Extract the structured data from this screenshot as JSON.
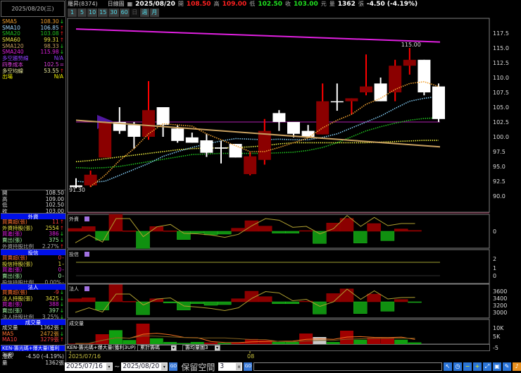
{
  "left_panel": {
    "date": "2025/08/20(三)",
    "ma_list": [
      {
        "label": "SMA5",
        "value": "108.30",
        "arrow": "↓",
        "color": "#f0a030",
        "dir": "dn"
      },
      {
        "label": "SMA10",
        "value": "106.85",
        "arrow": "↑",
        "color": "#a0d8ff",
        "dir": "up"
      },
      {
        "label": "SMA20",
        "value": "103.08",
        "arrow": "↑",
        "color": "#20c020",
        "dir": "up"
      },
      {
        "label": "SMA60",
        "value": "99.31",
        "arrow": "↑",
        "color": "#e8e040",
        "dir": "up"
      },
      {
        "label": "SMA120",
        "value": "98.33",
        "arrow": "↓",
        "color": "#c8a060",
        "dir": "dn"
      },
      {
        "label": "SMA240",
        "value": "115.98",
        "arrow": "↓",
        "color": "#e020e0",
        "dir": "dn"
      },
      {
        "label": "多空趨勢線",
        "value": "N/A",
        "arrow": "",
        "color": "#9040ff",
        "dir": ""
      },
      {
        "label": "四季成本",
        "value": "102.5",
        "arrow": "=",
        "color": "#e040e0",
        "dir": ""
      },
      {
        "label": "多空均線",
        "value": "53.55",
        "arrow": "↑",
        "color": "#f0f0a0",
        "dir": "up"
      },
      {
        "label": "出場",
        "value": "N/A",
        "arrow": "",
        "color": "#f0f000",
        "dir": ""
      }
    ],
    "ohlc": [
      {
        "label": "開",
        "value": "108.50"
      },
      {
        "label": "高",
        "value": "109.00"
      },
      {
        "label": "低",
        "value": "102.50"
      },
      {
        "label": "收",
        "value": "103.00"
      }
    ],
    "sections": [
      {
        "title": "外資",
        "rows": [
          {
            "label": "買賣超(張)",
            "value": "11",
            "arrow": "↑",
            "lc": "#ff7030",
            "vc": "#ff4040",
            "dir": "up"
          },
          {
            "label": "外資持股(張)",
            "value": "2554",
            "arrow": "↑",
            "lc": "#e8e040",
            "vc": "#e8e040",
            "dir": "up"
          },
          {
            "label": "買進(張)",
            "value": "386",
            "arrow": "↓",
            "lc": "#e020e0",
            "vc": "#e020e0",
            "dir": "dn"
          },
          {
            "label": "賣出(張)",
            "value": "375",
            "arrow": "↓",
            "lc": "#a0f0a0",
            "vc": "#a0f0a0",
            "dir": "dn"
          },
          {
            "label": "外資持股比例",
            "value": "2.27%",
            "arrow": "↑",
            "lc": "#aaa",
            "vc": "#aaa",
            "dir": "up"
          }
        ]
      },
      {
        "title": "投信",
        "rows": [
          {
            "label": "買賣超(張)",
            "value": "0",
            "arrow": "-",
            "lc": "#ff7030",
            "vc": "#ff4040",
            "dir": ""
          },
          {
            "label": "投信持股(張)",
            "value": "1",
            "arrow": "-",
            "lc": "#e8e040",
            "vc": "#e8e040",
            "dir": ""
          },
          {
            "label": "買進(張)",
            "value": "0",
            "arrow": "-",
            "lc": "#e020e0",
            "vc": "#e020e0",
            "dir": ""
          },
          {
            "label": "賣出(張)",
            "value": "0",
            "arrow": "-",
            "lc": "#a0f0a0",
            "vc": "#a0f0a0",
            "dir": ""
          },
          {
            "label": "投信持股比例",
            "value": "0.00%",
            "arrow": "-",
            "lc": "#aaa",
            "vc": "#aaa",
            "dir": ""
          }
        ]
      },
      {
        "title": "法人",
        "rows": [
          {
            "label": "買賣超(張)",
            "value": "-9",
            "arrow": "↓",
            "lc": "#ff7030",
            "vc": "#ff4040",
            "dir": "dn"
          },
          {
            "label": "法人持股(張)",
            "value": "3425",
            "arrow": "↓",
            "lc": "#e8e040",
            "vc": "#e8e040",
            "dir": "dn"
          },
          {
            "label": "買進(張)",
            "value": "388",
            "arrow": "↓",
            "lc": "#e020e0",
            "vc": "#e020e0",
            "dir": "dn"
          },
          {
            "label": "賣出(張)",
            "value": "397",
            "arrow": "↓",
            "lc": "#a0f0a0",
            "vc": "#a0f0a0",
            "dir": "dn"
          },
          {
            "label": "法人持股比例",
            "value": "3.25%",
            "arrow": "↓",
            "lc": "#aaa",
            "vc": "#aaa",
            "dir": "dn"
          }
        ]
      },
      {
        "title": "成交量",
        "rows": [
          {
            "label": "成交量",
            "value": "1362張",
            "arrow": "↓",
            "lc": "#ddd",
            "vc": "#ddd",
            "dir": "dn"
          },
          {
            "label": "MA5",
            "value": "2472張",
            "arrow": "↓",
            "lc": "#ff7030",
            "vc": "#f0a030",
            "dir": "dn"
          },
          {
            "label": "MA10",
            "value": "3279張",
            "arrow": "↑",
            "lc": "#ff4040",
            "vc": "#ff4040",
            "dir": "up"
          }
        ]
      }
    ],
    "indicator_title": "KEN-籌光碼+爆大量(獲利3UP)",
    "change_label": "漲跌",
    "change_value": "-4.50 (-4.19%)",
    "volume_label": "量",
    "volume_value": "1362張"
  },
  "header": {
    "stock": "羅昇(8374)",
    "chart_type": "日線圖",
    "date": "2025/08/20",
    "open_label": "開",
    "open": "108.50",
    "high_label": "高",
    "high": "109.00",
    "low_label": "低",
    "low": "102.50",
    "close_label": "收",
    "close": "103.00",
    "unit": "元",
    "vol_label": "量",
    "vol": "1362",
    "vol_unit": "張",
    "change": "-4.50 (-4.19%)"
  },
  "periods": [
    "1",
    "5",
    "10",
    "15",
    "30",
    "60",
    "日",
    "週",
    "月"
  ],
  "active_period": "日",
  "colors": {
    "up": "#8b0000",
    "down": "#ffffff",
    "up_wick": "#ff0000",
    "frame": "#808080"
  },
  "chart_data": [
    {
      "type": "candlestick",
      "yticks": [
        "117.5",
        "115.0",
        "112.5",
        "110.0",
        "107.5",
        "105.0",
        "102.5",
        "100.0",
        "97.5",
        "95.0",
        "92.5",
        "90.0"
      ],
      "ylim": [
        90,
        117.5
      ],
      "annotations": [
        {
          "text": "115.00",
          "index": 23
        },
        {
          "text": "91.30",
          "index": 0
        }
      ],
      "ohlc": [
        [
          91.8,
          93.0,
          91.3,
          91.5
        ],
        [
          91.8,
          94.3,
          91.5,
          93.6
        ],
        [
          96.5,
          102.6,
          96.5,
          102.5
        ],
        [
          102.5,
          105.0,
          100.5,
          101.0
        ],
        [
          102.0,
          102.5,
          98.0,
          100.0
        ],
        [
          100.0,
          109.4,
          99.5,
          104.5
        ],
        [
          105.0,
          105.0,
          100.0,
          102.0
        ],
        [
          101.4,
          101.9,
          99.0,
          99.3
        ],
        [
          99.9,
          100.7,
          99.0,
          99.0
        ],
        [
          99.4,
          100.5,
          96.6,
          97.3
        ],
        [
          98.2,
          99.3,
          95.5,
          98.0
        ],
        [
          98.8,
          98.8,
          96.5,
          96.5
        ],
        [
          93.7,
          97.4,
          93.5,
          96.7
        ],
        [
          96.1,
          103.0,
          95.3,
          101.0
        ],
        [
          104.0,
          104.5,
          101.0,
          102.5
        ],
        [
          102.5,
          102.5,
          99.9,
          100.5
        ],
        [
          101.0,
          102.0,
          99.8,
          100.0
        ],
        [
          100.4,
          109.0,
          100.4,
          106.0
        ],
        [
          106.0,
          109.0,
          104.4,
          106.0
        ],
        [
          106.0,
          106.5,
          103.8,
          106.5
        ],
        [
          107.5,
          113.9,
          107.0,
          108.5
        ],
        [
          109.0,
          110.0,
          106.0,
          106.0
        ],
        [
          107.5,
          113.0,
          106.0,
          112.0
        ],
        [
          112.0,
          115.0,
          110.5,
          113.0
        ],
        [
          113.0,
          113.0,
          107.0,
          107.5
        ],
        [
          108.5,
          109.0,
          102.5,
          103.0
        ]
      ],
      "ma": {
        "SMA5": [
          null,
          91.6,
          93.5,
          96,
          98,
          100.5,
          102.2,
          102,
          101.8,
          100.5,
          99.5,
          98.5,
          97.5,
          97.5,
          98.2,
          99,
          99.8,
          101.5,
          102.8,
          103.8,
          105.5,
          106.5,
          108,
          109,
          109.3,
          108.5
        ],
        "SMA10": [
          92.5,
          92.3,
          92.5,
          93.5,
          94.5,
          95.5,
          96.7,
          97.5,
          98.2,
          98.8,
          99.3,
          99.7,
          99.6,
          99.5,
          99.6,
          99.5,
          99.5,
          99.9,
          100.5,
          101.5,
          102.5,
          103.5,
          104.8,
          106,
          106.5,
          106.8
        ],
        "SMA20": [
          94.8,
          94.7,
          94.8,
          95,
          95.4,
          95.8,
          96.2,
          96.6,
          97,
          97.1,
          97.2,
          97.2,
          97.2,
          97.2,
          97.3,
          97.4,
          97.7,
          98.2,
          99,
          100,
          101,
          101.7,
          102.3,
          102.8,
          103.1,
          103.2
        ],
        "SMA60": [
          95.8,
          96,
          96.3,
          96.6,
          96.9,
          97.2,
          97.5,
          97.8,
          98,
          98.1,
          98.1,
          98.2,
          98.3,
          98.5,
          98.8,
          99,
          99,
          99,
          99,
          99,
          99,
          99.1,
          99.2,
          99.3,
          99.4,
          99.4
        ],
        "SMA120": [
          102.8,
          98.3
        ],
        "SMA240": [
          118.2,
          116.0
        ]
      },
      "season_cost": 102.5
    },
    {
      "type": "bar",
      "title": "外資",
      "yticks": [
        "0"
      ],
      "values": [
        36,
        60,
        -114,
        216,
        6,
        -219,
        60,
        6,
        -105,
        -24,
        -45,
        -36,
        39,
        135,
        66,
        -24,
        -24,
        9,
        -156,
        105,
        165,
        -150,
        99,
        -120,
        30,
        11
      ],
      "line": [
        148,
        115,
        145,
        45,
        45,
        122,
        80,
        70,
        108,
        110,
        115,
        125,
        112,
        75,
        45,
        52,
        82,
        78,
        110,
        88,
        32,
        78,
        40,
        75,
        66,
        66
      ]
    },
    {
      "type": "bar",
      "title": "投信",
      "yticks": [
        "2",
        "1",
        "0"
      ],
      "values": [
        0
      ],
      "line_value": 1
    },
    {
      "type": "bar",
      "title": "法人",
      "yticks": [
        "3600",
        "3400",
        "3200",
        "3000"
      ],
      "values": [
        39,
        51,
        -105,
        219,
        6,
        -165,
        39,
        -15,
        -105,
        -24,
        -45,
        -36,
        39,
        135,
        66,
        -24,
        -24,
        9,
        -156,
        105,
        165,
        -150,
        99,
        -120,
        30,
        -9
      ],
      "line": [
        3000,
        3130,
        3010,
        3520,
        3520,
        3210,
        3380,
        3410,
        3180,
        3150,
        3110,
        3050,
        3130,
        3400,
        3590,
        3550,
        3330,
        3370,
        3170,
        3300,
        3660,
        3370,
        3610,
        3380,
        3420,
        3425
      ]
    },
    {
      "type": "bar",
      "title": "成交量",
      "yticks": [
        "10K",
        "5K"
      ],
      "values": [
        700,
        1000,
        6000,
        8300,
        2700,
        12000,
        3700,
        1600,
        1000,
        1600,
        1300,
        1000,
        1300,
        3300,
        2700,
        1600,
        1600,
        6400,
        4400,
        1600,
        8000,
        2900,
        4000,
        4000,
        2900,
        1362
      ],
      "colors": [
        "r",
        "r",
        "r",
        "g",
        "g",
        "r",
        "g",
        "g",
        "g",
        "g",
        "r",
        "g",
        "r",
        "r",
        "r",
        "g",
        "g",
        "r",
        "w",
        "g",
        "r",
        "g",
        "r",
        "r",
        "g",
        "g"
      ]
    }
  ],
  "date_axis": {
    "start": "2025/07/16",
    "month": "08"
  },
  "indicator_row": {
    "select1": "累計籌碼",
    "select2": "籌均量圖3",
    "scale": "-5"
  },
  "bottom": {
    "from": "2025/07/16",
    "tilde": "~",
    "to": "2025/08/20",
    "go": "GO",
    "keep_label": "保留空間",
    "keep_value": "3"
  }
}
